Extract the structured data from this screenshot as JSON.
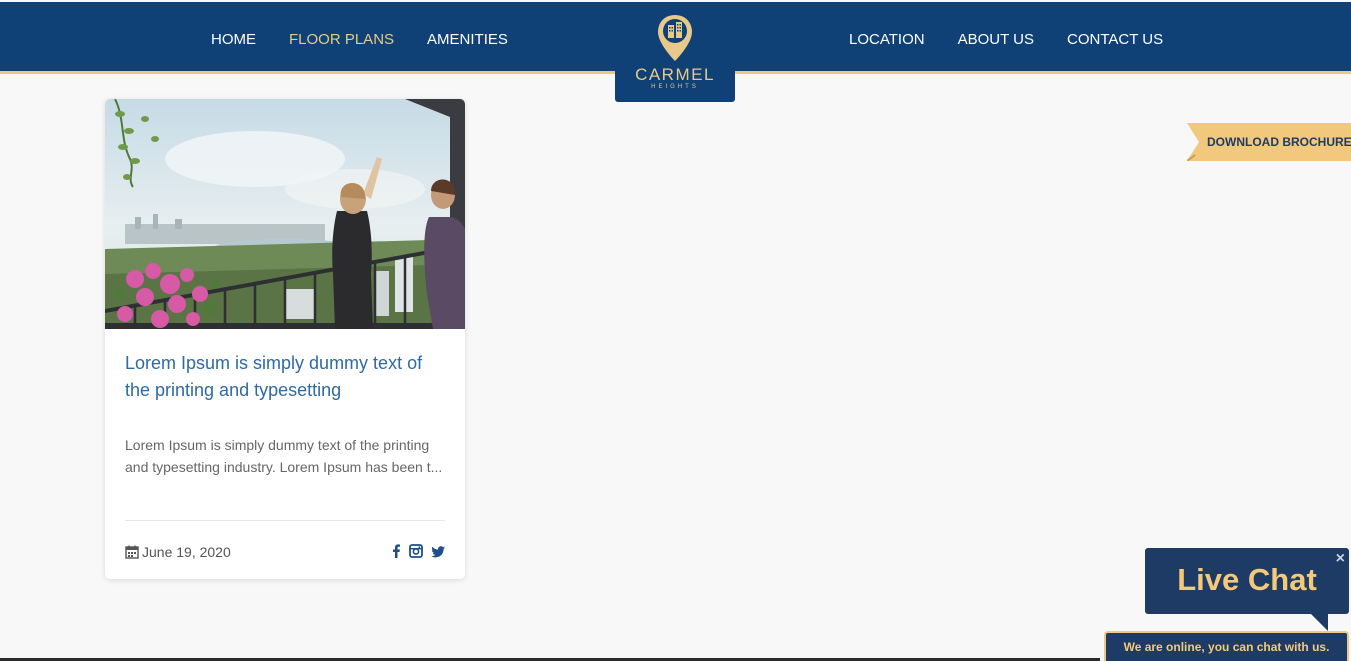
{
  "nav": {
    "left": [
      {
        "label": "HOME",
        "active": false
      },
      {
        "label": "FLOOR PLANS",
        "active": true
      },
      {
        "label": "AMENITIES",
        "active": false
      }
    ],
    "right": [
      {
        "label": "LOCATION"
      },
      {
        "label": "ABOUT US"
      },
      {
        "label": "CONTACT US"
      }
    ]
  },
  "logo": {
    "name": "CARMEL",
    "sub": "HEIGHTS",
    "icon": "location-pin-building-icon"
  },
  "post": {
    "title": "Lorem Ipsum is simply dummy text of the printing and typesetting",
    "excerpt": "Lorem Ipsum is simply dummy text of the printing and typesetting industry. Lorem Ipsum has been t...",
    "date": "June 19, 2020",
    "date_icon": "calendar-icon",
    "social": [
      "facebook-icon",
      "instagram-icon",
      "twitter-icon"
    ]
  },
  "brochure": {
    "label": "DOWNLOAD BROCHURE"
  },
  "chat": {
    "title": "Live Chat",
    "close": "×",
    "status": "We are online, you can chat with us."
  },
  "colors": {
    "navy": "#0f4176",
    "gold": "#e8c98a",
    "chat_navy": "#1e3b66",
    "chat_gold": "#f4c97a",
    "link_blue": "#2e6aa3"
  }
}
